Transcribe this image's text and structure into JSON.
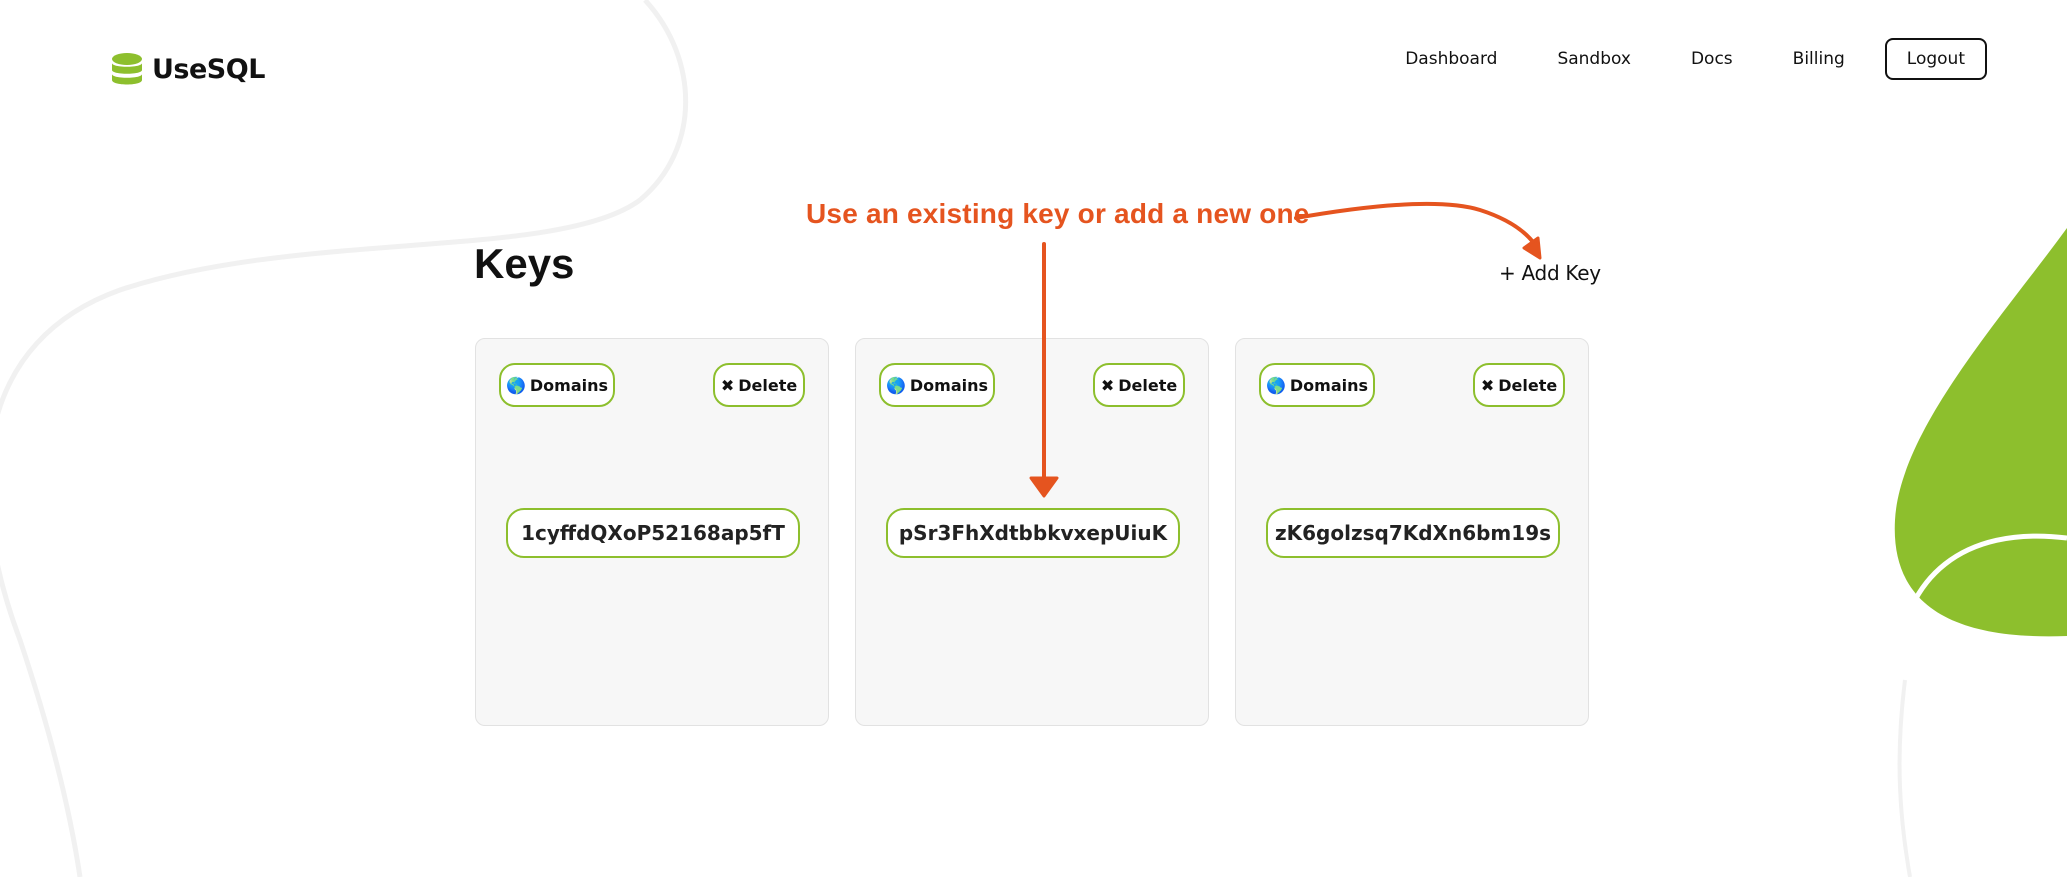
{
  "brand": {
    "name": "UseSQL",
    "logo_icon": "database-icon",
    "accent_color": "#8dbf2d"
  },
  "nav": {
    "items": [
      {
        "label": "Dashboard"
      },
      {
        "label": "Sandbox"
      },
      {
        "label": "Docs"
      },
      {
        "label": "Billing"
      }
    ],
    "logout_label": "Logout"
  },
  "main": {
    "title": "Keys",
    "add_key_label": "+ Add Key",
    "annotation": {
      "text": "Use an existing key or add a new one",
      "color": "#e5541f"
    },
    "keys": [
      {
        "domains_icon": "🌎",
        "domains_label": "Domains",
        "delete_icon": "✖",
        "delete_label": "Delete",
        "value": "1cyffdQXoP52168ap5fT"
      },
      {
        "domains_icon": "🌎",
        "domains_label": "Domains",
        "delete_icon": "✖",
        "delete_label": "Delete",
        "value": "pSr3FhXdtbbkvxepUiuK"
      },
      {
        "domains_icon": "🌎",
        "domains_label": "Domains",
        "delete_icon": "✖",
        "delete_label": "Delete",
        "value": "zK6golzsq7KdXn6bm19s"
      }
    ]
  }
}
